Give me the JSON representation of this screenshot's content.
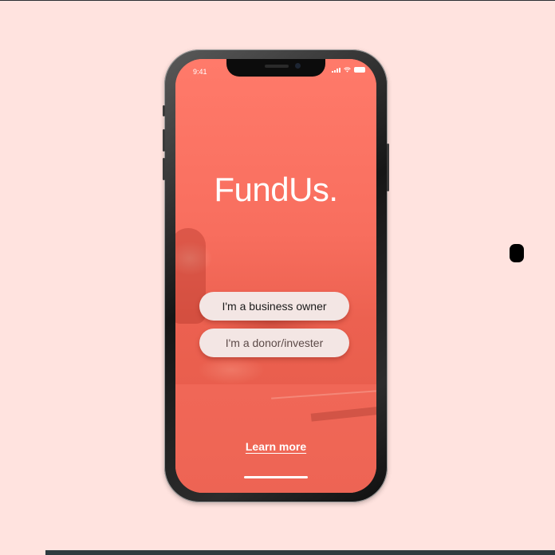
{
  "status_bar": {
    "time": "9:41",
    "icons": [
      "signal-icon",
      "wifi-icon",
      "battery-icon"
    ]
  },
  "app": {
    "logo": "FundUs."
  },
  "buttons": {
    "business_owner": "I'm a business owner",
    "donor": "I'm a donor/invester"
  },
  "footer": {
    "learn_more": "Learn more"
  },
  "colors": {
    "background": "#ffe3df",
    "screen_overlay": "#ee6554",
    "button_bg": "#f3e6e4"
  }
}
